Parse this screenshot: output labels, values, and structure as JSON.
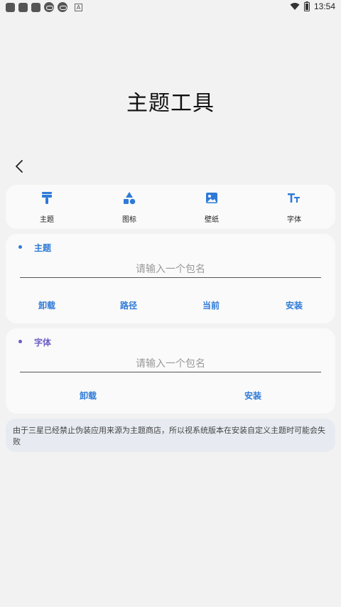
{
  "status_bar": {
    "time": "13:54",
    "notif_letter": "A"
  },
  "page_title": "主题工具",
  "tabs": [
    {
      "label": "主题",
      "icon": "brush-icon"
    },
    {
      "label": "图标",
      "icon": "shapes-icon"
    },
    {
      "label": "壁纸",
      "icon": "image-icon"
    },
    {
      "label": "字体",
      "icon": "font-icon"
    }
  ],
  "theme_section": {
    "title": "主题",
    "color": "#2f7ad7",
    "placeholder": "请输入一个包名",
    "buttons": [
      "卸载",
      "路径",
      "当前",
      "安装"
    ]
  },
  "font_section": {
    "title": "字体",
    "color": "#6a5fc7",
    "placeholder": "请输入一个包名",
    "buttons": [
      "卸载",
      "安装"
    ]
  },
  "notice": "由于三星已经禁止伪装应用来源为主题商店，所以视系统版本在安装自定义主题时可能会失败",
  "colors": {
    "accent": "#2f7ad7",
    "font_accent": "#6a5fc7",
    "background": "#f2f2f2"
  }
}
